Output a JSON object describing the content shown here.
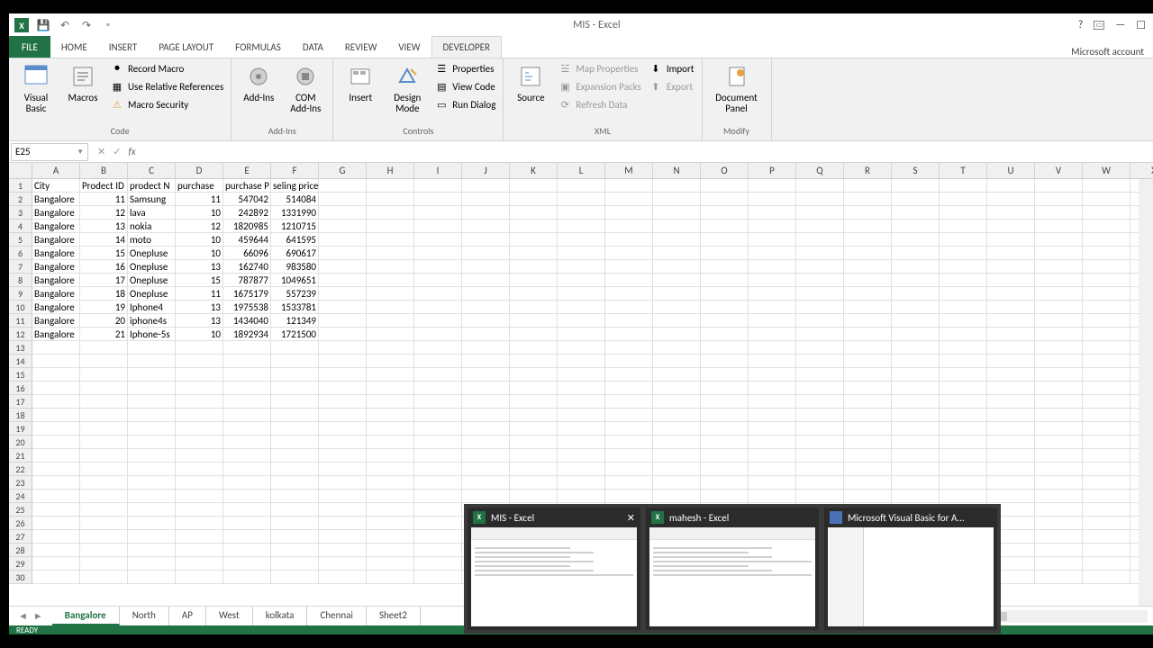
{
  "window": {
    "title": "MIS - Excel",
    "account": "Microsoft account"
  },
  "tabs": {
    "file": "FILE",
    "list": [
      "HOME",
      "INSERT",
      "PAGE LAYOUT",
      "FORMULAS",
      "DATA",
      "REVIEW",
      "VIEW",
      "DEVELOPER"
    ],
    "active": "DEVELOPER"
  },
  "ribbon": {
    "code": {
      "visual_basic": "Visual\nBasic",
      "macros": "Macros",
      "record_macro": "Record Macro",
      "use_relative": "Use Relative References",
      "macro_security": "Macro Security",
      "label": "Code"
    },
    "addins": {
      "addins": "Add-Ins",
      "com_addins": "COM\nAdd-Ins",
      "label": "Add-Ins"
    },
    "controls": {
      "insert": "Insert",
      "design_mode": "Design\nMode",
      "properties": "Properties",
      "view_code": "View Code",
      "run_dialog": "Run Dialog",
      "label": "Controls"
    },
    "xml": {
      "source": "Source",
      "map_properties": "Map Properties",
      "expansion_packs": "Expansion Packs",
      "refresh_data": "Refresh Data",
      "import": "Import",
      "export": "Export",
      "label": "XML"
    },
    "modify": {
      "document_panel": "Document\nPanel",
      "label": "Modify"
    }
  },
  "formula_bar": {
    "name_box": "E25",
    "fx": "fx"
  },
  "columns": [
    "A",
    "B",
    "C",
    "D",
    "E",
    "F",
    "G",
    "H",
    "I",
    "J",
    "K",
    "L",
    "M",
    "N",
    "O",
    "P",
    "Q",
    "R",
    "S",
    "T",
    "U",
    "V",
    "W",
    "X"
  ],
  "row_count": 30,
  "headers": [
    "City",
    "Prodect ID",
    "prodect N",
    "purchase",
    "purchase P",
    "seling price"
  ],
  "rows": [
    [
      "Bangalore",
      "11",
      "Samsung",
      "11",
      "547042",
      "514084"
    ],
    [
      "Bangalore",
      "12",
      "lava",
      "10",
      "242892",
      "1331990"
    ],
    [
      "Bangalore",
      "13",
      "nokia",
      "12",
      "1820985",
      "1210715"
    ],
    [
      "Bangalore",
      "14",
      "moto",
      "10",
      "459644",
      "641595"
    ],
    [
      "Bangalore",
      "15",
      "Onepluse",
      "10",
      "66096",
      "690617"
    ],
    [
      "Bangalore",
      "16",
      "Onepluse",
      "13",
      "162740",
      "983580"
    ],
    [
      "Bangalore",
      "17",
      "Onepluse",
      "15",
      "787877",
      "1049651"
    ],
    [
      "Bangalore",
      "18",
      "Onepluse",
      "11",
      "1675179",
      "557239"
    ],
    [
      "Bangalore",
      "19",
      "Iphone4",
      "13",
      "1975538",
      "1533781"
    ],
    [
      "Bangalore",
      "20",
      "iphone4s",
      "13",
      "1434040",
      "121349"
    ],
    [
      "Bangalore",
      "21",
      "Iphone-5s",
      "10",
      "1892934",
      "1721500"
    ]
  ],
  "sheets": [
    "Bangalore",
    "North",
    "AP",
    "West",
    "kolkata",
    "Chennai",
    "Sheet2"
  ],
  "active_sheet": "Bangalore",
  "status": "READY",
  "previews": {
    "p1": "MIS - Excel",
    "p2": "mahesh - Excel",
    "p3": "Microsoft Visual Basic for A..."
  }
}
